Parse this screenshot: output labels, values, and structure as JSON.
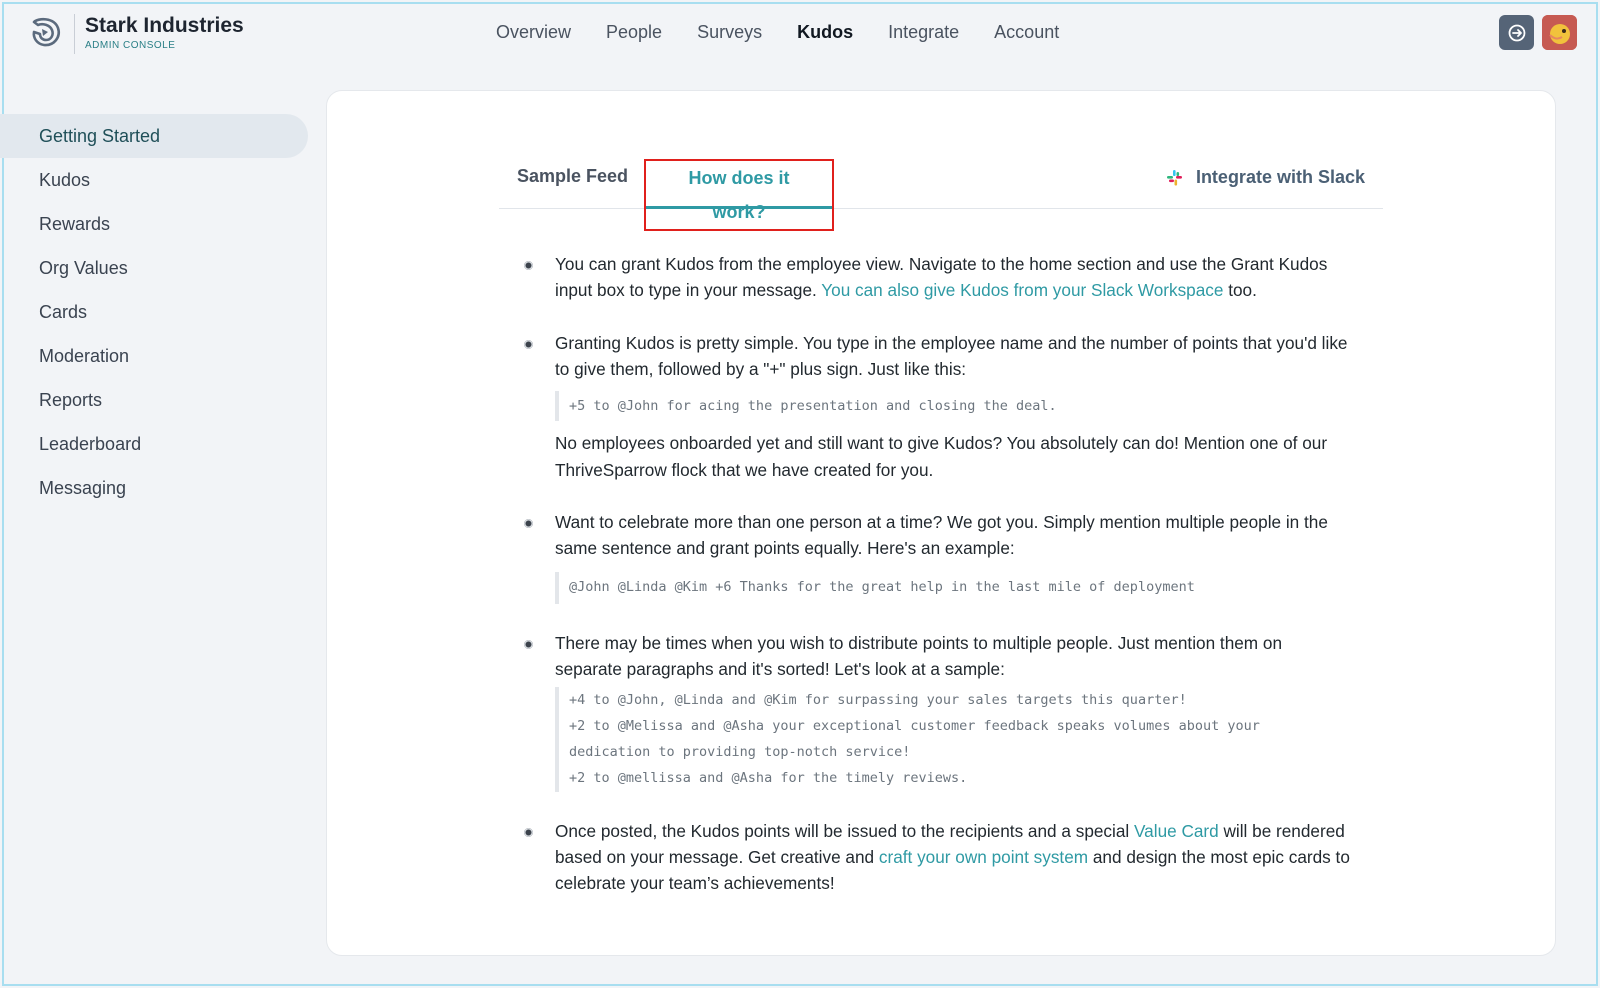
{
  "brand": {
    "name": "Stark Industries",
    "subtitle": "ADMIN CONSOLE"
  },
  "topnav": {
    "items": [
      {
        "label": "Overview"
      },
      {
        "label": "People"
      },
      {
        "label": "Surveys"
      },
      {
        "label": "Kudos",
        "active": true
      },
      {
        "label": "Integrate"
      },
      {
        "label": "Account"
      }
    ]
  },
  "header": {
    "help_icon": "help-icon",
    "avatar_icon": "avatar"
  },
  "sidebar": {
    "items": [
      {
        "label": "Getting Started",
        "active": true
      },
      {
        "label": "Kudos"
      },
      {
        "label": "Rewards"
      },
      {
        "label": "Org Values"
      },
      {
        "label": "Cards"
      },
      {
        "label": "Moderation"
      },
      {
        "label": "Reports"
      },
      {
        "label": "Leaderboard"
      },
      {
        "label": "Messaging"
      }
    ]
  },
  "tabs": {
    "sample_feed": "Sample Feed",
    "how_it_works": "How does it work?",
    "integrate_slack": "Integrate with Slack"
  },
  "bullets": {
    "b1": {
      "text": "You can grant Kudos from the employee view. Navigate to the home section and use the Grant Kudos input box to type in your message. ",
      "link": "You can also give Kudos from your Slack Workspace",
      "after": " too."
    },
    "b2": {
      "text": "Granting Kudos is pretty simple. You type in the employee name and the number of points that you'd like to give them, followed by a \"+\" plus sign. Just like this:",
      "code": "+5 to @John for acing the presentation and closing the deal.",
      "extra": "No employees onboarded yet and still want to give Kudos? You absolutely can do! Mention one of our ThriveSparrow flock that we have created for you."
    },
    "b3": {
      "text": "Want to celebrate more than one person at a time? We got you. Simply mention multiple people in the same sentence and grant points equally. Here's an example:",
      "code": "@John @Linda @Kim +6 Thanks for the great help in the last mile of deployment"
    },
    "b4": {
      "text": "There may be times when you wish to distribute points to multiple people. Just mention them on separate paragraphs and it's sorted! Let's look at a sample:",
      "code_lines": [
        "+4 to @John, @Linda and @Kim for surpassing your sales targets this quarter!",
        "+2 to @Melissa and @Asha your exceptional customer feedback speaks volumes about your",
        "dedication to providing top-notch service!",
        "+2 to @mellissa and @Asha for the timely reviews."
      ]
    },
    "b5": {
      "text1": "Once posted, the Kudos points will be issued to the recipients and a special ",
      "link1": "Value Card",
      "text2": " will be rendered based on your message. Get creative and ",
      "link2": "craft your own point system",
      "text3": " and design the most epic cards to celebrate your team’s achievements!"
    }
  },
  "colors": {
    "accent": "#2f9aa4",
    "highlight_box": "#e0201c",
    "background": "#f2f4f7",
    "sidebar_active": "#e2e8ee"
  }
}
